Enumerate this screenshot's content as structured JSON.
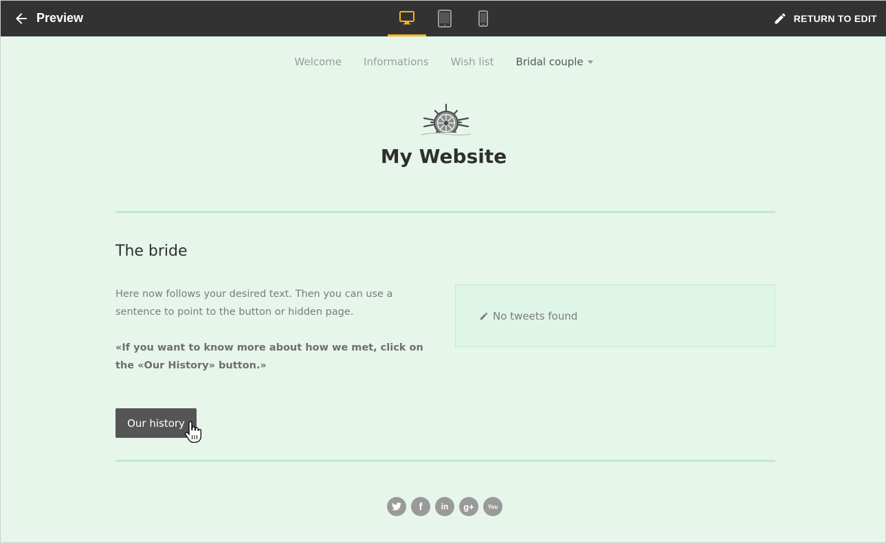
{
  "topbar": {
    "back_icon": "arrow-left-icon",
    "title": "Preview",
    "devices": [
      {
        "name": "desktop",
        "icon": "monitor-icon",
        "active": true,
        "color": "#f3b51c"
      },
      {
        "name": "tablet",
        "icon": "tablet-icon",
        "active": false
      },
      {
        "name": "mobile",
        "icon": "phone-icon",
        "active": false
      }
    ],
    "return_label": "RETURN TO EDIT",
    "return_icon": "pencil-icon"
  },
  "nav": {
    "items": [
      {
        "label": "Welcome"
      },
      {
        "label": "Informations"
      },
      {
        "label": "Wish list"
      },
      {
        "label": "Bridal couple"
      }
    ]
  },
  "header": {
    "logo_icon": "ship-wheel-icon",
    "title": "My Website"
  },
  "section": {
    "heading": "The bride",
    "body": "Here now follows your desired text. Then you can use a sentence to point to the button or hidden page.",
    "quote": "«If you want to know more about how we met, click on the «Our History» button.»",
    "button_label": "Our history"
  },
  "tweets": {
    "icon": "pencil-icon",
    "message": "No tweets found"
  },
  "social": [
    {
      "name": "twitter",
      "glyph": "t"
    },
    {
      "name": "facebook",
      "glyph": "f"
    },
    {
      "name": "linkedin",
      "glyph": "in"
    },
    {
      "name": "google-plus",
      "glyph": "g+"
    },
    {
      "name": "youtube",
      "glyph": "You"
    }
  ],
  "colors": {
    "topbar": "#323232",
    "accent": "#f3b51c",
    "page_bg": "#e6f6eb",
    "divider": "#bfe8d2",
    "button": "#555555"
  }
}
